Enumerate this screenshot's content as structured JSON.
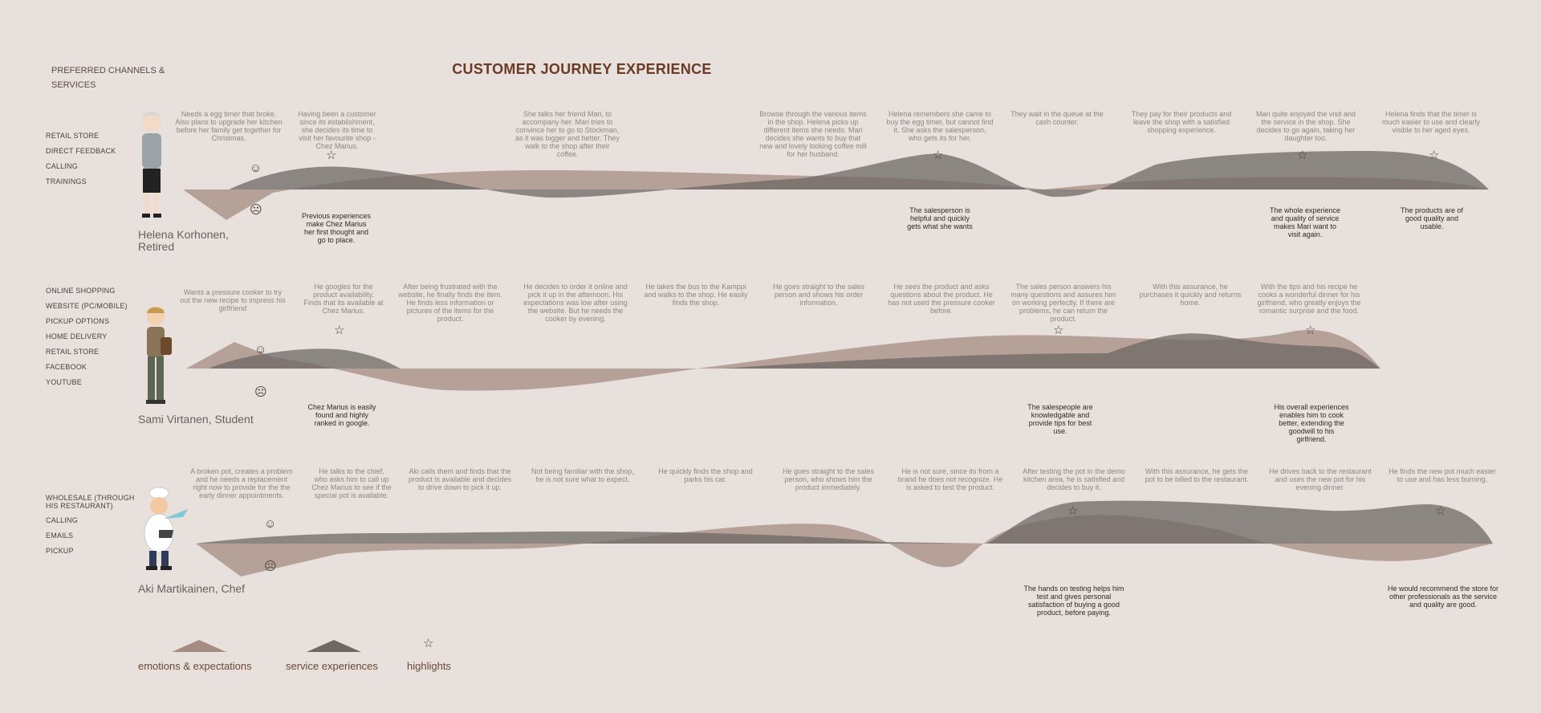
{
  "title": "CUSTOMER JOURNEY EXPERIENCE",
  "preferred": "PREFERRED  CHANNELS & SERVICES",
  "colors": {
    "emotion": "#a48c80",
    "service": "#6e6864",
    "background": "#e8e0dc",
    "title": "#6b3a25"
  },
  "face_icons": {
    "smile": "☺",
    "sad": "☹",
    "star": "☆"
  },
  "personas": [
    {
      "name": "Helena Korhonen, Retired",
      "channels": [
        "RETAIL STORE",
        "DIRECT FEEDBACK",
        "CALLING",
        "TRAININGS"
      ],
      "notes": [
        "Needs a egg timer that broke. Also plans to upgrade her kitchen before her family get together for Christmas.",
        "Having been a customer since its establishment, she decides its time to visit her favourite shop - Chez Marius.",
        "She talks her friend Mari, to accompany her. Mari tries to convince her to go to Stockman, as it was bigger and better. They walk to the shop after their coffee.",
        "Browse through the various items in the shop. Helena picks up different items she needs.  Mari decides she wants to buy that new and lovely looking coffee mill for her husband.",
        "Helena remembers she came to buy the egg timer, but cannot find it. She asks the salesperson, who gets its for her.",
        "They wait in the queue at the cash counter.",
        "They pay for their products and leave the shop with a  satisfied shopping experience.",
        "Mari quite enjoyed the visit and the service in the shop. She decides to go again, taking her daughter too.",
        "Helena finds that the timer is much easier to use and  clearly visible to her aged eyes."
      ],
      "highlights": [
        "Previous experiences make Chez Marius her first thought and go to place.",
        "The salesperson is helpful and quickly gets what she wants",
        "The whole experience and quality of service makes Mari want to visit again.",
        "The products are of good quality and usable."
      ]
    },
    {
      "name": "Sami Virtanen, Student",
      "channels": [
        "ONLINE SHOPPING",
        "WEBSITE (PC/MOBILE)",
        "PICKUP OPTIONS",
        "HOME DELIVERY",
        "RETAIL STORE",
        "FACEBOOK",
        "YOUTUBE"
      ],
      "notes": [
        "Wants a pressure cooker to try out the new recipe to impress his girlfriend",
        "He googles for the product availability. Finds that its available at Chez Marius.",
        "After being frustrated with the website, he finally finds the item.  He finds less information or pictures of the items for the product.",
        "He decides to order it online and pick it up in the afternoon. His expectations was low after using the website. But he needs the cooker by evening.",
        "He takes the bus to the Kamppi and walks to the shop. He easily finds the shop.",
        "He goes straight to the sales person and shows his order information.",
        "He sees the product and asks questions about the product. He has not used the pressure cooker before.",
        "The sales person answers his many questions and assures him on working perfectly. If there are problems, he can return the product.",
        "With this assurance, he purchases it quickly and returns home.",
        "With the tips and his recipe he cooks a wonderful dinner for his girlfriend, who  greatly enjoys the romantic surprise and the food."
      ],
      "highlights": [
        "Chez Marius is easily found and highly ranked in google.",
        "The salespeople are knowledgable and provide tips for best use.",
        "His overall experiences enables him to cook better, extending the goodwill to his girlfriend."
      ]
    },
    {
      "name": "Aki Martikainen, Chef",
      "channels": [
        "WHOLESALE (THROUGH HIS RESTAURANT)",
        "CALLING",
        "EMAILS",
        "PICKUP"
      ],
      "notes": [
        "A broken pot, creates a problem and he needs a replacement right now to provide for the the early dinner appointments.",
        "He talks to the chief, who asks him to call up Chez Marius to see if the special pot is available.",
        "Aki calls them and finds that the product is available and decides to drive down to pick it up.",
        "Not being familiar with the shop, he is not sure what to expect.",
        "He quickly finds the shop and parks his car.",
        "He goes straight to the sales person, who shows him the product immediately.",
        "He is not sure, since its from a brand he does not recognize. He is asked to test the product.",
        "After testing the pot in the demo kitchen area, he is satisfied and decides to buy it.",
        "With this assurance, he gets the pot to be billed to the restaurant.",
        "He drives back to the restaurant and uses the new pot for his evening dinner.",
        "He finds the new pot much easier to use and has less burning."
      ],
      "highlights": [
        "The hands on testing helps him test and gives personal satisfaction of buying a good product, before paying.",
        "He would recommend the store for other professionals as the service and quality are good."
      ]
    }
  ],
  "legend": {
    "emotion": "emotions & expectations",
    "service": "service experiences",
    "highlights": "highlights"
  }
}
